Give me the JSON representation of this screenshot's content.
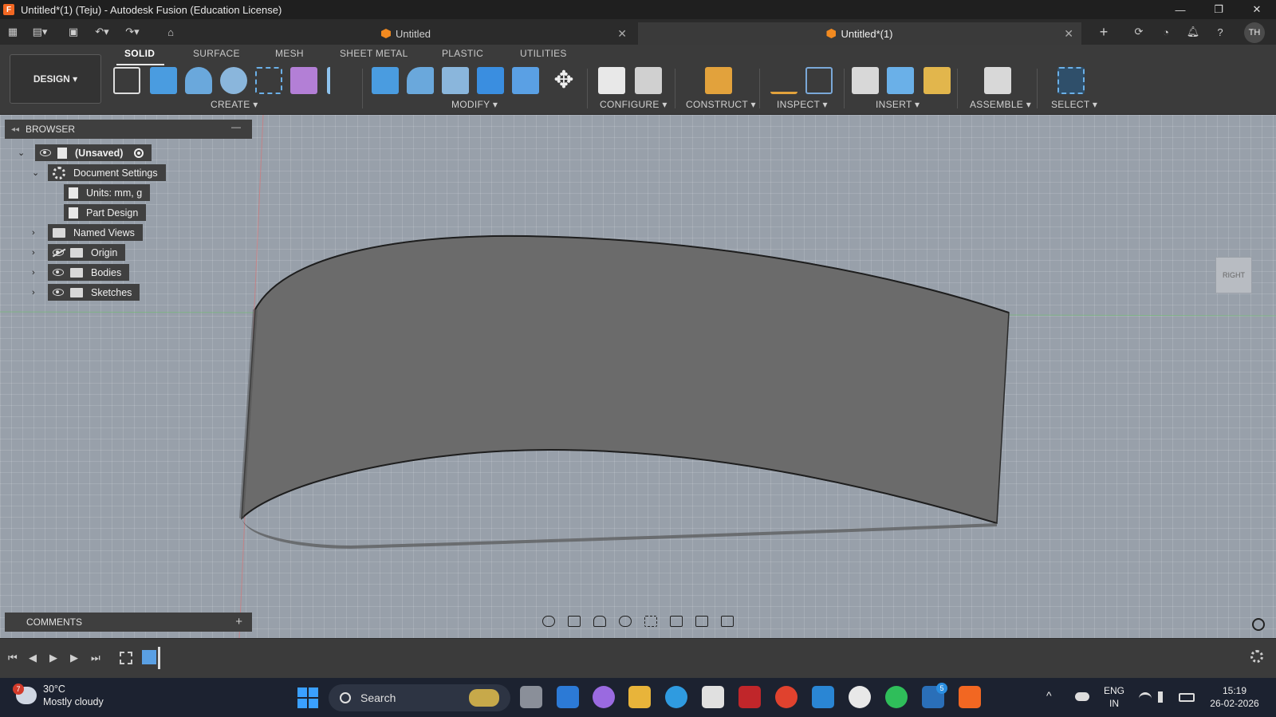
{
  "window": {
    "title": "Untitled*(1) (Teju) - Autodesk Fusion (Education License)",
    "app_icon": "F"
  },
  "tabs": [
    {
      "label": "Untitled",
      "active": false
    },
    {
      "label": "Untitled*(1)",
      "active": true
    }
  ],
  "user": {
    "initials": "TH"
  },
  "toolbar": {
    "workspace": "DESIGN",
    "workspace_tabs": [
      "SOLID",
      "SURFACE",
      "MESH",
      "SHEET METAL",
      "PLASTIC",
      "UTILITIES"
    ],
    "groups": [
      "CREATE",
      "MODIFY",
      "CONFIGURE",
      "CONSTRUCT",
      "INSPECT",
      "INSERT",
      "ASSEMBLE",
      "SELECT"
    ]
  },
  "browser": {
    "title": "BROWSER",
    "root": "(Unsaved)",
    "items": [
      {
        "label": "Document Settings"
      },
      {
        "label": "Units: mm, g"
      },
      {
        "label": "Part Design"
      },
      {
        "label": "Named Views"
      },
      {
        "label": "Origin"
      },
      {
        "label": "Bodies"
      },
      {
        "label": "Sketches"
      }
    ]
  },
  "comments": {
    "title": "COMMENTS"
  },
  "viewcube": {
    "face": "RIGHT"
  },
  "taskbar": {
    "weather_temp": "30°C",
    "weather_desc": "Mostly cloudy",
    "weather_badge": "7",
    "search": "Search",
    "lang": "ENG",
    "region": "IN",
    "time": "15:19",
    "date": "26-02-2026",
    "linkedin_badge": "5"
  },
  "colors": {
    "accent": "#f26722",
    "viewport": "#98a0aa",
    "panel": "#3b3b3b"
  }
}
